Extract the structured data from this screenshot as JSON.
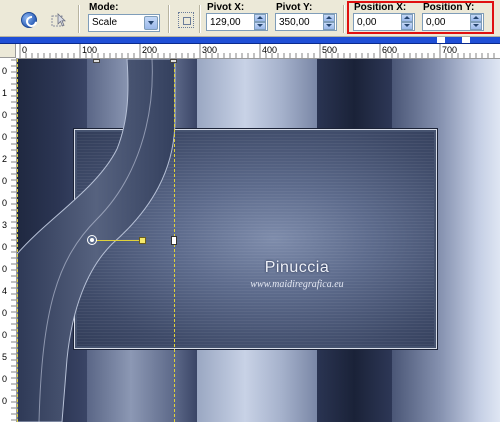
{
  "toolbar": {
    "mode": {
      "label": "Mode:",
      "value": "Scale"
    },
    "pivot_x": {
      "label": "Pivot X:",
      "value": "129,00"
    },
    "pivot_y": {
      "label": "Pivot Y:",
      "value": "350,00"
    },
    "position_x": {
      "label": "Position X:",
      "value": "0,00"
    },
    "position_y": {
      "label": "Position Y:",
      "value": "0,00"
    }
  },
  "ruler": {
    "top_labels": [
      "0",
      "100",
      "200",
      "300",
      "400",
      "500",
      "600",
      "700"
    ],
    "left_labels": [
      "0",
      "1",
      "0",
      "0",
      "2",
      "0",
      "0",
      "3",
      "0",
      "0",
      "4",
      "0",
      "0",
      "5",
      "0",
      "0"
    ]
  },
  "canvas": {
    "watermark_title": "Pinuccia",
    "watermark_url": "www.maidiregrafica.eu"
  },
  "colors": {
    "highlight": "#e01010",
    "guide": "#e0d23a",
    "accent_strip": "#1f4fd6"
  }
}
